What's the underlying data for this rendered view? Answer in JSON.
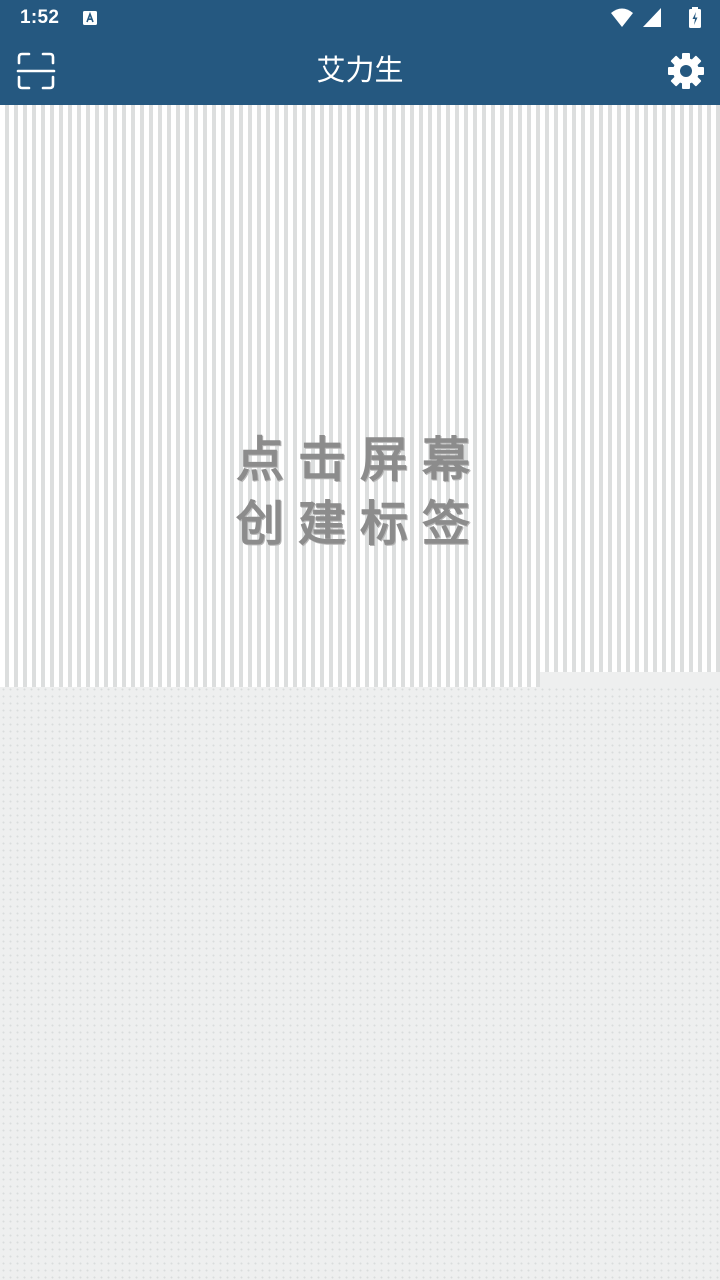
{
  "status_bar": {
    "time": "1:52",
    "notification_icon": "a-text-icon",
    "indicators": [
      "wifi-icon",
      "cellular-signal-icon",
      "battery-charging-icon"
    ]
  },
  "app_bar": {
    "title": "艾力生",
    "left_icon": "scan-icon",
    "right_icon": "gear-icon",
    "background_color": "#255880"
  },
  "canvas": {
    "hint_line1": "点击屏幕",
    "hint_line2": "创建标签"
  }
}
